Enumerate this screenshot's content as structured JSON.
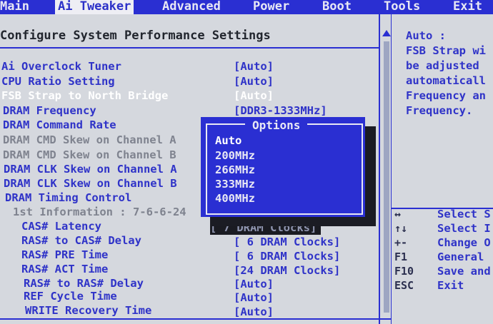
{
  "menu": {
    "items": [
      "Main",
      "Ai Tweaker",
      "Advanced",
      "Power",
      "Boot",
      "Tools",
      "Exit"
    ],
    "active": "Ai Tweaker"
  },
  "main": {
    "title": "Configure System Performance Settings",
    "settings": [
      {
        "label": "Ai Overclock Tuner",
        "value": "[Auto]"
      },
      {
        "label": "CPU Ratio Setting",
        "value": "[Auto]"
      },
      {
        "label": "FSB Strap to North Bridge",
        "value": "[Auto]"
      },
      {
        "label": "DRAM Frequency",
        "value": "[DDR3-1333MHz]"
      },
      {
        "label": "DRAM Command Rate",
        "value": ""
      },
      {
        "label": "DRAM CMD Skew on Channel A",
        "value": ""
      },
      {
        "label": "DRAM CMD Skew on Channel B",
        "value": ""
      },
      {
        "label": "DRAM CLK Skew on Channel A",
        "value": ""
      },
      {
        "label": "DRAM CLK Skew on Channel B",
        "value": ""
      },
      {
        "label": "DRAM Timing Control",
        "value": ""
      },
      {
        "label": "1st Information : 7-6-6-24",
        "value": ""
      },
      {
        "label": "CAS# Latency",
        "value": "[ 7 DRAM Clocks]"
      },
      {
        "label": "RAS# to CAS# Delay",
        "value": "[ 6 DRAM Clocks]"
      },
      {
        "label": "RAS# PRE Time",
        "value": "[ 6 DRAM Clocks]"
      },
      {
        "label": "RAS# ACT Time",
        "value": "[24 DRAM Clocks]"
      },
      {
        "label": "RAS# to RAS# Delay",
        "value": "[Auto]"
      },
      {
        "label": "REF Cycle Time",
        "value": "[Auto]"
      },
      {
        "label": "WRITE Recovery Time",
        "value": "[Auto]"
      }
    ]
  },
  "popup": {
    "title": "Options",
    "options": [
      "Auto",
      "200MHz",
      "266MHz",
      "333MHz",
      "400MHz"
    ],
    "selected": "Auto"
  },
  "help": {
    "lines": [
      "Auto :",
      "FSB Strap wi",
      "be adjusted",
      "automaticall",
      "Frequency an",
      "Frequency."
    ],
    "keys": [
      {
        "key": "↔",
        "desc": "Select S"
      },
      {
        "key": "↑↓",
        "desc": "Select I"
      },
      {
        "key": "+-",
        "desc": "Change O"
      },
      {
        "key": "F1",
        "desc": "General"
      },
      {
        "key": "F10",
        "desc": "Save and"
      },
      {
        "key": "ESC",
        "desc": "Exit"
      }
    ]
  },
  "colors": {
    "bios_blue": "#2a2fd2",
    "background_grey": "#d5d8de",
    "highlight_white": "#ffffff"
  }
}
